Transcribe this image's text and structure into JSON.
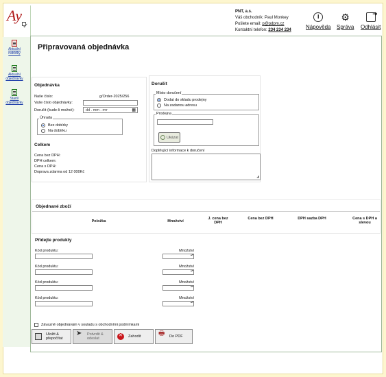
{
  "header": {
    "company": "PNT, a.s.",
    "rep_label": "Váš obchodník:",
    "rep_name": "Paul Monkey",
    "email_label": "Pošlete email:",
    "email": "p@pdpm.cz",
    "phone_label": "Kontaktní telefon:",
    "phone": "234 234 234"
  },
  "topnav": {
    "help": "Nápověda",
    "admin": "Správa",
    "logout": "Odhlásit"
  },
  "sidebar": {
    "items": [
      {
        "label": "Aktuální nabídky",
        "icon": "document-icon"
      },
      {
        "label": "Aktuální objednávky",
        "icon": "document-icon"
      },
      {
        "label": "Starší objednávky",
        "icon": "document-icon"
      }
    ]
  },
  "page": {
    "title": "Připravovaná objednávka"
  },
  "order": {
    "title": "Objednávka",
    "our_no_label": "Naše číslo:",
    "our_no": "g/Order-2025/256",
    "your_no_label": "Vaše číslo objednávky:",
    "deliver_label": "Doručit (bude-li možné):",
    "date_placeholder": "dd . mm . rrrr",
    "payment_legend": "Úhrada",
    "payment_opt1": "Bez dobírky",
    "payment_opt2": "Na dobírku"
  },
  "totals": {
    "title": "Celkem",
    "no_vat": "Cena bez DPH:",
    "vat": "DPH celkem:",
    "with_vat": "Cena s DPH:",
    "free_shipping": "Doprava zdarma od 12 000Kč"
  },
  "delivery": {
    "title": "Doručit",
    "place_legend": "Místo doručení",
    "place_opt1": "Dodat do skladu prodejny",
    "place_opt2": "Na zadanou adresu",
    "store_legend": "Prodejna",
    "show_button": "Ukázat",
    "extra_label": "Doplňující informace k doručení"
  },
  "products": {
    "title": "Objednané zboží",
    "columns": [
      "Položka",
      "Množství",
      "J. cena bez DPH",
      "Cena bez DPH",
      "DPH sazba DPH",
      "Cena s DPH a slevou"
    ]
  },
  "add": {
    "title": "Přidejte produkty",
    "code_label": "Kód produktu:",
    "qty_label": "Množství"
  },
  "footer": {
    "terms": "Závazně objednávám v souladu s obchodními podmínkami",
    "save": "Uložit & přepočítat",
    "send": "Potvrdit & odeslat",
    "cancel": "Zahodit",
    "pdf": "Do PDF"
  },
  "colors": {
    "background": "#fdf6cf",
    "accent_green": "#1d7a1d",
    "logo_red": "#b01c1c",
    "link_blue": "#1a3aa8"
  }
}
